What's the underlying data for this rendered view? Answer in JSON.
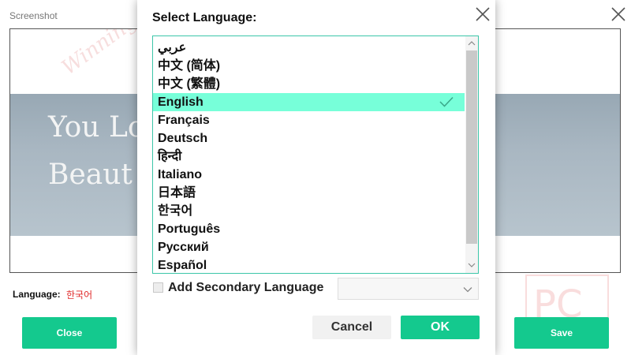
{
  "background_window": {
    "title": "Screenshot",
    "image_text_line1": "You Lo",
    "image_text_line2": "Beaut",
    "watermark_text": "WinningPC",
    "logo_text": "PC",
    "language_label": "Language:",
    "language_value": "한국어",
    "close_label": "Close",
    "save_label": "Save"
  },
  "dialog": {
    "title": "Select Language:",
    "languages": [
      {
        "label": "عربي",
        "selected": false
      },
      {
        "label": "中文 (简体)",
        "selected": false
      },
      {
        "label": "中文 (繁體)",
        "selected": false
      },
      {
        "label": "English",
        "selected": true
      },
      {
        "label": "Français",
        "selected": false
      },
      {
        "label": "Deutsch",
        "selected": false
      },
      {
        "label": "हिन्दी",
        "selected": false
      },
      {
        "label": "Italiano",
        "selected": false
      },
      {
        "label": "日本語",
        "selected": false
      },
      {
        "label": "한국어",
        "selected": false
      },
      {
        "label": "Português",
        "selected": false
      },
      {
        "label": "Русский",
        "selected": false
      },
      {
        "label": "Español",
        "selected": false
      }
    ],
    "secondary_label": "Add Secondary Language",
    "secondary_checked": false,
    "secondary_value": "",
    "cancel_label": "Cancel",
    "ok_label": "OK"
  },
  "colors": {
    "accent": "#14c98e",
    "selection": "#77ffd9",
    "list_border": "#3cc6a9",
    "language_value": "#e02b2b"
  }
}
